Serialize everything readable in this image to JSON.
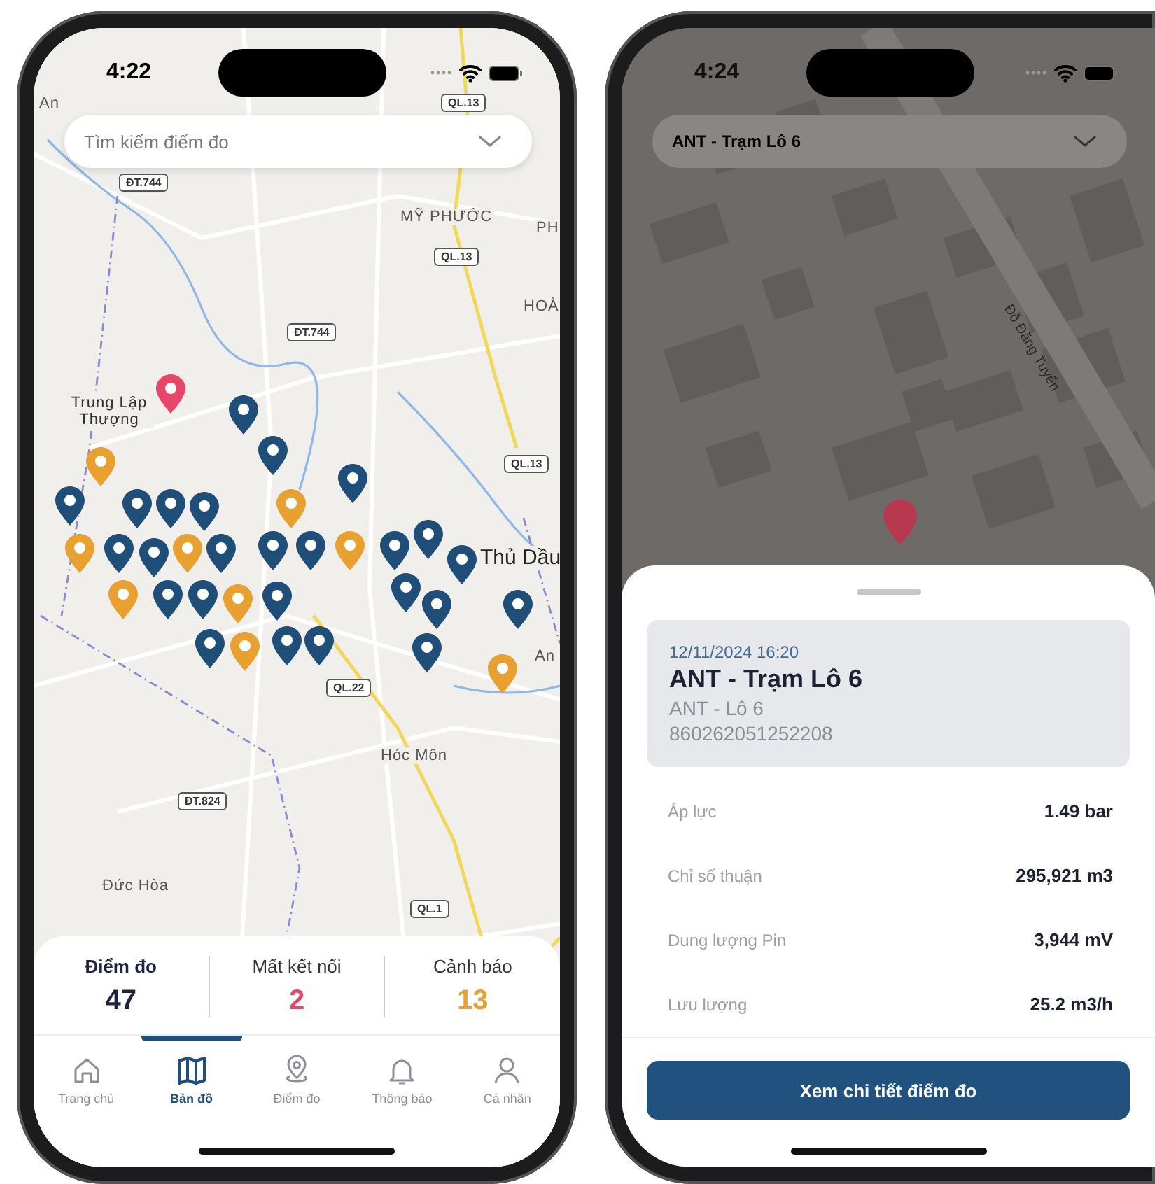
{
  "map_screen": {
    "status_bar": {
      "time": "4:22"
    },
    "search": {
      "placeholder": "Tìm kiếm điểm đo"
    },
    "map": {
      "labels": [
        {
          "text": "An"
        },
        {
          "text": "MỸ PHƯỚC"
        },
        {
          "text": "PH"
        },
        {
          "text": "HOÀ"
        },
        {
          "text": "Trung Lập Thượng"
        },
        {
          "text": "Thủ Dầu"
        },
        {
          "text": "An"
        },
        {
          "text": "Hóc Môn"
        },
        {
          "text": "Đức Hòa"
        }
      ],
      "road_signs": [
        {
          "text": "QL.13"
        },
        {
          "text": "ĐT.744"
        },
        {
          "text": "QL.13"
        },
        {
          "text": "ĐT.744"
        },
        {
          "text": "QL.13"
        },
        {
          "text": "QL.22"
        },
        {
          "text": "ĐT.824"
        },
        {
          "text": "QL.1"
        }
      ],
      "pins": [
        {
          "color": "#e8a131"
        },
        {
          "color": "#e8a131"
        },
        {
          "color": "#e8a131"
        },
        {
          "color": "#e8a131"
        },
        {
          "color": "#e8a131"
        },
        {
          "color": "#e8a131"
        },
        {
          "color": "#e8a131"
        },
        {
          "color": "#e8a131"
        },
        {
          "color": "#e8a131"
        },
        {
          "color": "#e8476a"
        },
        {
          "color": "#1f4e79"
        },
        {
          "color": "#1f4e79"
        },
        {
          "color": "#1f4e79"
        },
        {
          "color": "#1f4e79"
        },
        {
          "color": "#1f4e79"
        },
        {
          "color": "#1f4e79"
        },
        {
          "color": "#1f4e79"
        },
        {
          "color": "#1f4e79"
        },
        {
          "color": "#1f4e79"
        },
        {
          "color": "#1f4e79"
        },
        {
          "color": "#1f4e79"
        },
        {
          "color": "#1f4e79"
        },
        {
          "color": "#1f4e79"
        },
        {
          "color": "#1f4e79"
        },
        {
          "color": "#1f4e79"
        },
        {
          "color": "#1f4e79"
        },
        {
          "color": "#1f4e79"
        },
        {
          "color": "#1f4e79"
        },
        {
          "color": "#1f4e79"
        },
        {
          "color": "#1f4e79"
        },
        {
          "color": "#1f4e79"
        },
        {
          "color": "#1f4e79"
        },
        {
          "color": "#1f4e79"
        },
        {
          "color": "#1f4e79"
        },
        {
          "color": "#1f4e79"
        }
      ]
    },
    "summary": [
      {
        "label": "Điểm đo",
        "value": "47",
        "color": "#1d2340"
      },
      {
        "label": "Mất kết nối",
        "value": "2",
        "color": "#e8476a"
      },
      {
        "label": "Cảnh báo",
        "value": "13",
        "color": "#e8a131"
      }
    ],
    "tabs": [
      {
        "label": "Trang chủ",
        "kind": "home",
        "selected": false
      },
      {
        "label": "Bản đồ",
        "kind": "map",
        "selected": true
      },
      {
        "label": "Điểm đo",
        "kind": "pin",
        "selected": false
      },
      {
        "label": "Thông báo",
        "kind": "bell",
        "selected": false
      },
      {
        "label": "Cá nhân",
        "kind": "person",
        "selected": false
      }
    ]
  },
  "detail_screen": {
    "status_bar": {
      "time": "4:24"
    },
    "station_select": {
      "value": "ANT - Trạm Lô 6"
    },
    "map": {
      "street_label": "Đỗ Đăng Tuyển"
    },
    "sheet": {
      "timestamp": "12/11/2024 16:20",
      "title": "ANT - Trạm Lô 6",
      "subtitle": "ANT - Lô 6",
      "device_id": "860262051252208",
      "readings": [
        {
          "label": "Áp lực",
          "value": "1.49 bar"
        },
        {
          "label": "Chỉ số thuận",
          "value": "295,921 m3"
        },
        {
          "label": "Dung lượng Pin",
          "value": "3,944 mV"
        },
        {
          "label": "Lưu lượng",
          "value": "25.2 m3/h"
        }
      ],
      "button": "Xem chi tiết điểm đo"
    }
  }
}
